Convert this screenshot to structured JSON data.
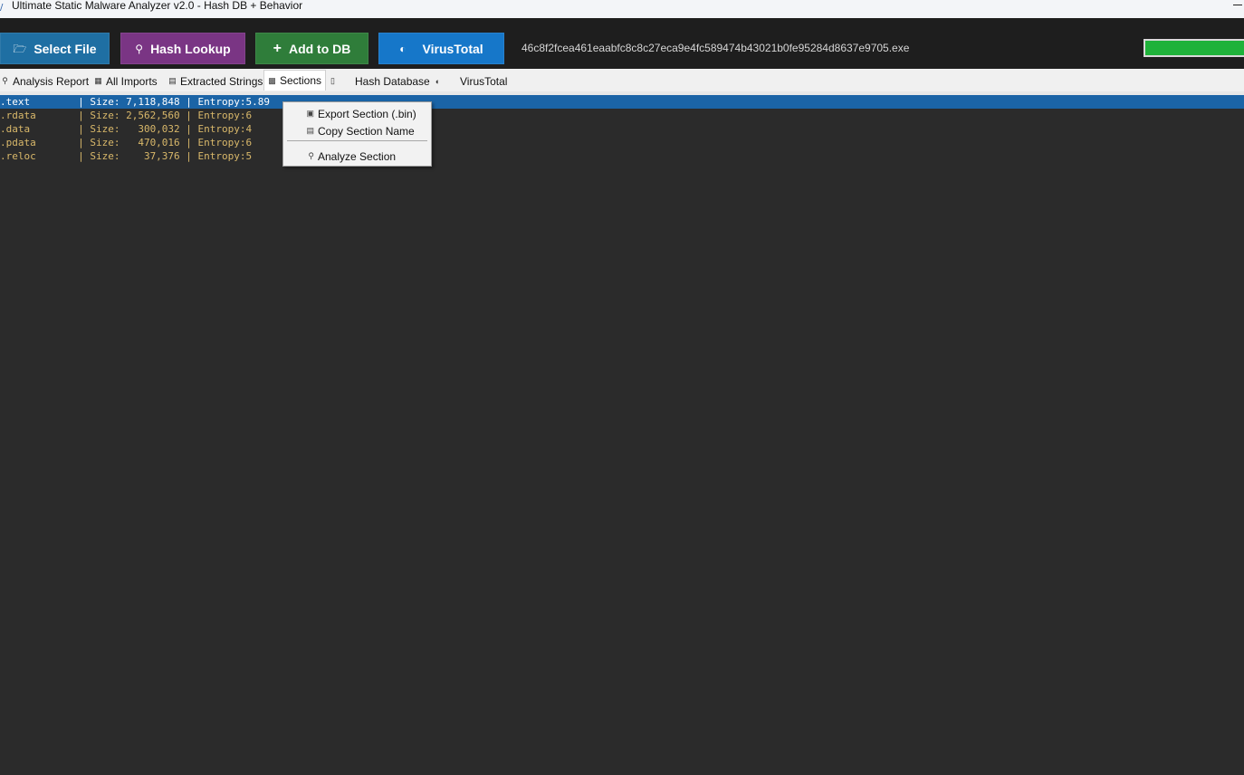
{
  "window": {
    "title": "Ultimate Static Malware Analyzer v2.0 - Hash DB + Behavior"
  },
  "toolbar": {
    "select_file": "Select File",
    "hash_lookup": "Hash Lookup",
    "add_to_db": "Add to DB",
    "virustotal": "VirusTotal",
    "file_name": "46c8f2fcea461eaabfc8c8c27eca9e4fc589474b43021b0fe95284d8637e9705.exe",
    "progress_fraction": 1.0,
    "colors": {
      "select_file": "#1f6fa3",
      "hash_lookup": "#7a3584",
      "add_to_db": "#2f7d3a",
      "virustotal": "#1677c9",
      "progress": "#1fb23a"
    },
    "icons": {
      "select_file": "folder-icon",
      "hash_lookup": "key-icon",
      "add_to_db": "plus-icon",
      "virustotal": "half-circle-icon"
    }
  },
  "tabs": [
    {
      "label": "Analysis Report",
      "icon": "magnifier-icon"
    },
    {
      "label": "All Imports",
      "icon": "package-icon"
    },
    {
      "label": "Extracted Strings",
      "icon": "document-icon"
    },
    {
      "label": "Sections",
      "icon": "chart-icon",
      "active": true
    },
    {
      "label": "Hash Database",
      "icon": "clipboard-icon"
    },
    {
      "label": "VirusTotal",
      "icon": "half-circle-icon"
    }
  ],
  "sections": [
    {
      "text": ".text        | Size: 7,118,848 | Entropy:5.89",
      "selected": true
    },
    {
      "text": ".rdata       | Size: 2,562,560 | Entropy:6",
      "selected": false
    },
    {
      "text": ".data        | Size:   300,032 | Entropy:4",
      "selected": false
    },
    {
      "text": ".pdata       | Size:   470,016 | Entropy:6",
      "selected": false
    },
    {
      "text": ".reloc       | Size:    37,376 | Entropy:5",
      "selected": false
    }
  ],
  "context_menu": {
    "items": [
      {
        "label": "Export Section (.bin)",
        "icon": "save-icon"
      },
      {
        "label": "Copy Section Name",
        "icon": "clipboard-icon"
      },
      {
        "label": "Analyze Section",
        "icon": "magnifier-icon"
      }
    ]
  }
}
